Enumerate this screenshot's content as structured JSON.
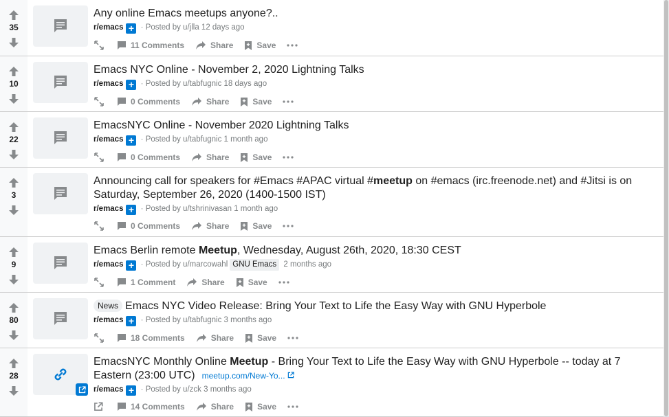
{
  "posts": [
    {
      "score": "35",
      "title": "Any online Emacs meetups anyone?..",
      "subreddit": "r/emacs",
      "posted_by": "Posted by u/jlla",
      "age": "12 days ago",
      "comments": "11 Comments",
      "share": "Share",
      "save": "Save"
    },
    {
      "score": "10",
      "title": "Emacs NYC Online - November 2, 2020 Lightning Talks",
      "subreddit": "r/emacs",
      "posted_by": "Posted by u/tabfugnic",
      "age": "18 days ago",
      "comments": "0 Comments",
      "share": "Share",
      "save": "Save"
    },
    {
      "score": "22",
      "title": "EmacsNYC Online - November 2020 Lightning Talks",
      "subreddit": "r/emacs",
      "posted_by": "Posted by u/tabfugnic",
      "age": "1 month ago",
      "comments": "0 Comments",
      "share": "Share",
      "save": "Save"
    },
    {
      "score": "3",
      "title_a": "Announcing call for speakers for #Emacs #APAC virtual #",
      "title_b": "meetup",
      "title_c": " on #emacs (irc.freenode.net) and #Jitsi is on Saturday, September 26, 2020 (1400-1500 IST)",
      "subreddit": "r/emacs",
      "posted_by": "Posted by u/tshrinivasan",
      "age": "1 month ago",
      "comments": "0 Comments",
      "share": "Share",
      "save": "Save"
    },
    {
      "score": "9",
      "title_a": "Emacs Berlin remote ",
      "title_b": "Meetup",
      "title_c": ", Wednesday, August 26th, 2020, 18:30 CEST",
      "subreddit": "r/emacs",
      "posted_by": "Posted by u/marcowahl",
      "user_flair": "GNU Emacs",
      "age": "2 months ago",
      "comments": "1 Comment",
      "share": "Share",
      "save": "Save"
    },
    {
      "score": "80",
      "flair": "News",
      "title": "Emacs NYC Video Release: Bring Your Text to Life the Easy Way with GNU Hyperbole",
      "subreddit": "r/emacs",
      "posted_by": "Posted by u/tabfugnic",
      "age": "3 months ago",
      "comments": "18 Comments",
      "share": "Share",
      "save": "Save"
    },
    {
      "score": "28",
      "title_a": "EmacsNYC Monthly Online ",
      "title_b": "Meetup",
      "title_c": " - Bring Your Text to Life the Easy Way with GNU Hyperbole -- today at 7 Eastern (23:00 UTC)",
      "domain": "meetup.com/New-Yo...",
      "subreddit": "r/emacs",
      "posted_by": "Posted by u/zck",
      "age": "3 months ago",
      "comments": "14 Comments",
      "share": "Share",
      "save": "Save"
    }
  ],
  "colors": {
    "accent": "#0079d3",
    "icon": "#878a8c"
  },
  "icons": {
    "upvote": "arrow-up-icon",
    "downvote": "arrow-down-icon",
    "text_post": "text-post-icon",
    "link_post": "link-icon",
    "expand": "expand-icon",
    "comment": "comment-icon",
    "share": "share-icon",
    "save": "bookmark-plus-icon",
    "more": "more-icon",
    "external": "external-link-icon"
  }
}
